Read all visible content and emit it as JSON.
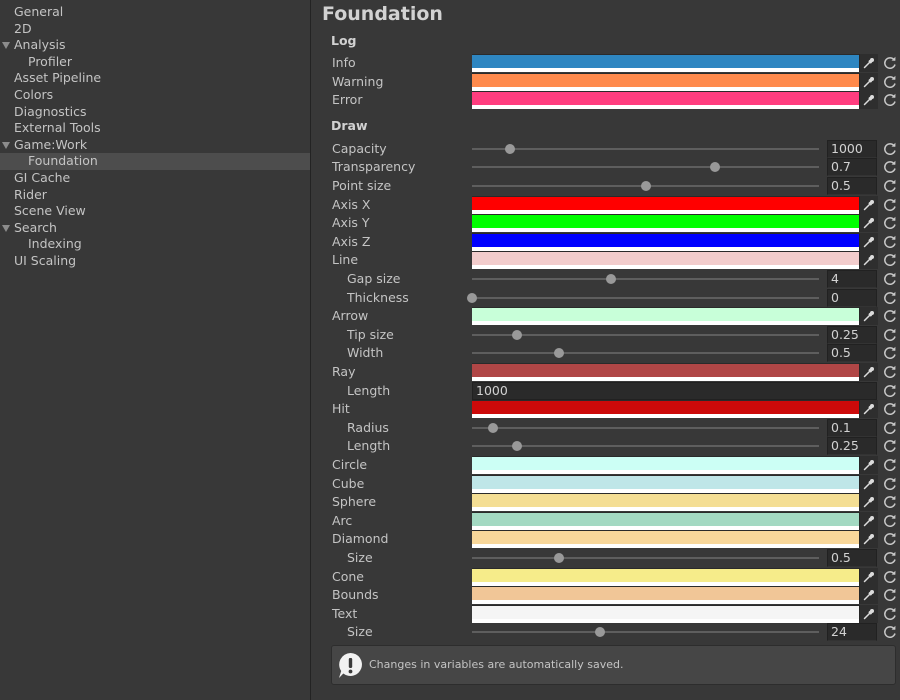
{
  "sidebar": {
    "items": [
      {
        "label": "General",
        "indent": 0,
        "expandable": false,
        "selected": false
      },
      {
        "label": "2D",
        "indent": 0,
        "expandable": false,
        "selected": false
      },
      {
        "label": "Analysis",
        "indent": 0,
        "expandable": true,
        "selected": false
      },
      {
        "label": "Profiler",
        "indent": 1,
        "expandable": false,
        "selected": false
      },
      {
        "label": "Asset Pipeline",
        "indent": 0,
        "expandable": false,
        "selected": false
      },
      {
        "label": "Colors",
        "indent": 0,
        "expandable": false,
        "selected": false
      },
      {
        "label": "Diagnostics",
        "indent": 0,
        "expandable": false,
        "selected": false
      },
      {
        "label": "External Tools",
        "indent": 0,
        "expandable": false,
        "selected": false
      },
      {
        "label": "Game:Work",
        "indent": 0,
        "expandable": true,
        "selected": false
      },
      {
        "label": "Foundation",
        "indent": 1,
        "expandable": false,
        "selected": true
      },
      {
        "label": "GI Cache",
        "indent": 0,
        "expandable": false,
        "selected": false
      },
      {
        "label": "Rider",
        "indent": 0,
        "expandable": false,
        "selected": false
      },
      {
        "label": "Scene View",
        "indent": 0,
        "expandable": false,
        "selected": false
      },
      {
        "label": "Search",
        "indent": 0,
        "expandable": true,
        "selected": false
      },
      {
        "label": "Indexing",
        "indent": 1,
        "expandable": false,
        "selected": false
      },
      {
        "label": "UI Scaling",
        "indent": 0,
        "expandable": false,
        "selected": false
      }
    ]
  },
  "main": {
    "title": "Foundation",
    "sections": {
      "log": "Log",
      "draw": "Draw"
    },
    "rows": [
      {
        "kind": "color",
        "label": "Info",
        "indent": 0,
        "color": "#2e86c1"
      },
      {
        "kind": "color",
        "label": "Warning",
        "indent": 0,
        "color": "#ff8a4c"
      },
      {
        "kind": "color",
        "label": "Error",
        "indent": 0,
        "color": "#ff3d7f"
      },
      {
        "kind": "slider",
        "label": "Capacity",
        "indent": 0,
        "value": "1000",
        "fraction": 0.11
      },
      {
        "kind": "slider",
        "label": "Transparency",
        "indent": 0,
        "value": "0.7",
        "fraction": 0.7
      },
      {
        "kind": "slider",
        "label": "Point size",
        "indent": 0,
        "value": "0.5",
        "fraction": 0.5
      },
      {
        "kind": "color",
        "label": "Axis X",
        "indent": 0,
        "color": "#ff0000"
      },
      {
        "kind": "color",
        "label": "Axis Y",
        "indent": 0,
        "color": "#00ff00"
      },
      {
        "kind": "color",
        "label": "Axis Z",
        "indent": 0,
        "color": "#0000ff"
      },
      {
        "kind": "color",
        "label": "Line",
        "indent": 0,
        "color": "#f2cccc"
      },
      {
        "kind": "slider",
        "label": "Gap size",
        "indent": 1,
        "value": "4",
        "fraction": 0.4
      },
      {
        "kind": "slider",
        "label": "Thickness",
        "indent": 1,
        "value": "0",
        "fraction": 0.0
      },
      {
        "kind": "color",
        "label": "Arrow",
        "indent": 0,
        "color": "#c8ffd9"
      },
      {
        "kind": "slider",
        "label": "Tip size",
        "indent": 1,
        "value": "0.25",
        "fraction": 0.13
      },
      {
        "kind": "slider",
        "label": "Width",
        "indent": 1,
        "value": "0.5",
        "fraction": 0.25
      },
      {
        "kind": "color",
        "label": "Ray",
        "indent": 0,
        "color": "#b04646"
      },
      {
        "kind": "text",
        "label": "Length",
        "indent": 1,
        "value": "1000"
      },
      {
        "kind": "color",
        "label": "Hit",
        "indent": 0,
        "color": "#cc0a0a"
      },
      {
        "kind": "slider",
        "label": "Radius",
        "indent": 1,
        "value": "0.1",
        "fraction": 0.06
      },
      {
        "kind": "slider",
        "label": "Length",
        "indent": 1,
        "value": "0.25",
        "fraction": 0.13
      },
      {
        "kind": "color",
        "label": "Circle",
        "indent": 0,
        "color": "#ccfff5"
      },
      {
        "kind": "color",
        "label": "Cube",
        "indent": 0,
        "color": "#bfe6e8"
      },
      {
        "kind": "color",
        "label": "Sphere",
        "indent": 0,
        "color": "#f4de94"
      },
      {
        "kind": "color",
        "label": "Arc",
        "indent": 0,
        "color": "#a3d9c2"
      },
      {
        "kind": "color",
        "label": "Diamond",
        "indent": 0,
        "color": "#f8d79a"
      },
      {
        "kind": "slider",
        "label": "Size",
        "indent": 1,
        "value": "0.5",
        "fraction": 0.25
      },
      {
        "kind": "color",
        "label": "Cone",
        "indent": 0,
        "color": "#f6ec8a"
      },
      {
        "kind": "color",
        "label": "Bounds",
        "indent": 0,
        "color": "#f1c697"
      },
      {
        "kind": "color",
        "label": "Text",
        "indent": 0,
        "color": "#f5f5f5"
      },
      {
        "kind": "slider",
        "label": "Size",
        "indent": 1,
        "value": "24",
        "fraction": 0.37
      }
    ],
    "info": {
      "message": "Changes in variables are automatically saved."
    }
  },
  "icons": {
    "picker": "eyedropper-icon",
    "reset": "reset-icon",
    "info": "warning-info-icon"
  }
}
